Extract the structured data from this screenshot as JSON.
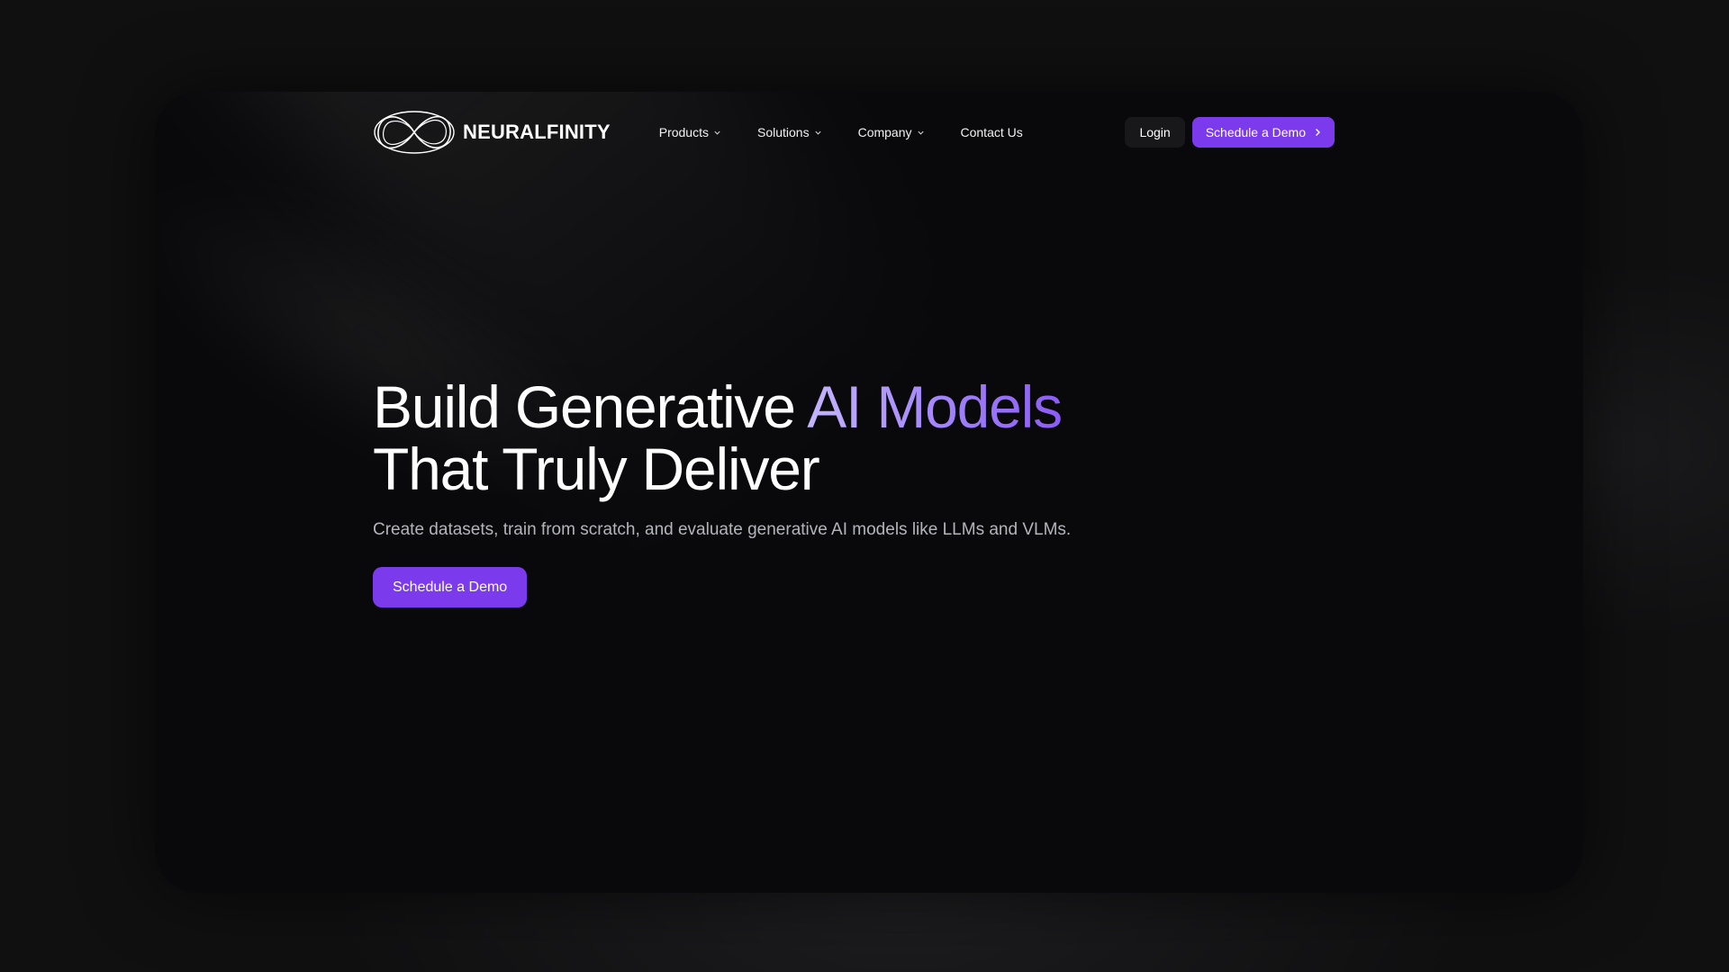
{
  "brand": {
    "name": "NEURALFINITY",
    "logo_icon": "infinity-logo-icon"
  },
  "nav": {
    "items": [
      {
        "label": "Products",
        "has_dropdown": true
      },
      {
        "label": "Solutions",
        "has_dropdown": true
      },
      {
        "label": "Company",
        "has_dropdown": true
      },
      {
        "label": "Contact Us",
        "has_dropdown": false
      }
    ],
    "login_label": "Login",
    "demo_label": "Schedule a Demo"
  },
  "hero": {
    "title_part1": "Build Generative ",
    "title_accent": "AI Models",
    "title_line2": "That Truly Deliver",
    "subtitle": "Create datasets, train from scratch, and evaluate generative AI models like LLMs and VLMs.",
    "cta_label": "Schedule a Demo"
  },
  "colors": {
    "background": "#09090b",
    "accent": "#7c3aed",
    "accent_gradient_start": "#c4b5fd",
    "accent_gradient_end": "#8b5cf6"
  }
}
